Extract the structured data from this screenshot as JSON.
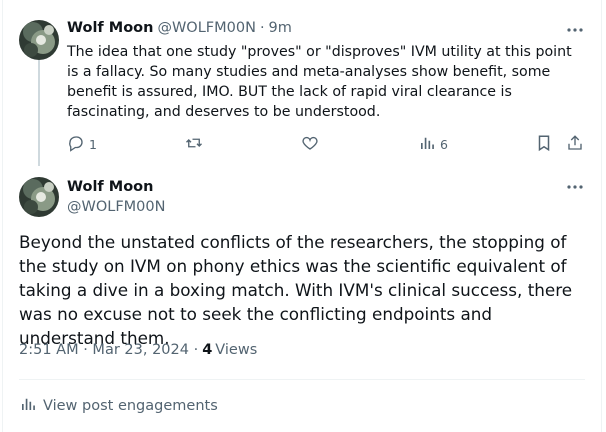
{
  "reply": {
    "author_name": "Wolf Moon",
    "author_handle": "@WOLFM00N",
    "separator": "·",
    "time": "9m",
    "text": "The idea that one study \"proves\" or \"disproves\" IVM utility at this point is a fallacy.  So many studies and meta-analyses show benefit, some benefit is assured, IMO.  BUT the lack of rapid viral clearance is fascinating, and deserves to be understood.",
    "actions": {
      "reply_count": "1",
      "repost_count": "",
      "like_count": "",
      "views_count": "6"
    }
  },
  "post": {
    "author_name": "Wolf Moon",
    "author_handle": "@WOLFM00N",
    "text": "Beyond the unstated conflicts of the researchers, the stopping of the study on IVM on phony ethics was the scientific equivalent of taking a dive in a boxing match.  With IVM's clinical success, there was no excuse not to seek the conflicting endpoints and understand them.",
    "timestamp": "2:51 AM · Mar 23, 2024 ·",
    "views_count": "4",
    "views_label": "Views",
    "engagements_link": "View post engagements"
  },
  "icons": {
    "more": "more-icon",
    "reply": "reply-icon",
    "repost": "repost-icon",
    "like": "heart-icon",
    "analytics": "analytics-icon",
    "bookmark": "bookmark-icon",
    "share": "share-icon"
  },
  "colors": {
    "text_primary": "#0f1419",
    "text_secondary": "#536471",
    "divider": "#eff3f4",
    "thread_line": "#cfd9de"
  }
}
